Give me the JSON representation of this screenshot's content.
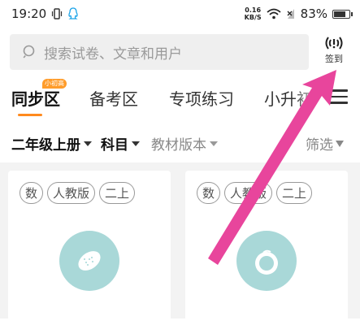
{
  "status_bar": {
    "time": "19:20",
    "net_speed_value": "0.16",
    "net_speed_unit": "KB/S",
    "battery": "83%",
    "battery_level": 0.83
  },
  "search": {
    "placeholder": "搜索试卷、文章和用户",
    "signin_label": "签到"
  },
  "tabs": [
    {
      "label": "同步区",
      "badge": "小初高"
    },
    {
      "label": "备考区"
    },
    {
      "label": "专项练习"
    },
    {
      "label": "小升初"
    }
  ],
  "filters": {
    "grade": "二年级上册",
    "subject": "科目",
    "edition": "教材版本",
    "screen": "筛选"
  },
  "cards": [
    {
      "tags": [
        "数",
        "人教版",
        "二上"
      ]
    },
    {
      "tags": [
        "数",
        "人教版",
        "二上"
      ]
    }
  ],
  "colors": {
    "accent": "#ff8a1e",
    "arrow": "#e8459c",
    "disc": "#a9d8d8"
  }
}
